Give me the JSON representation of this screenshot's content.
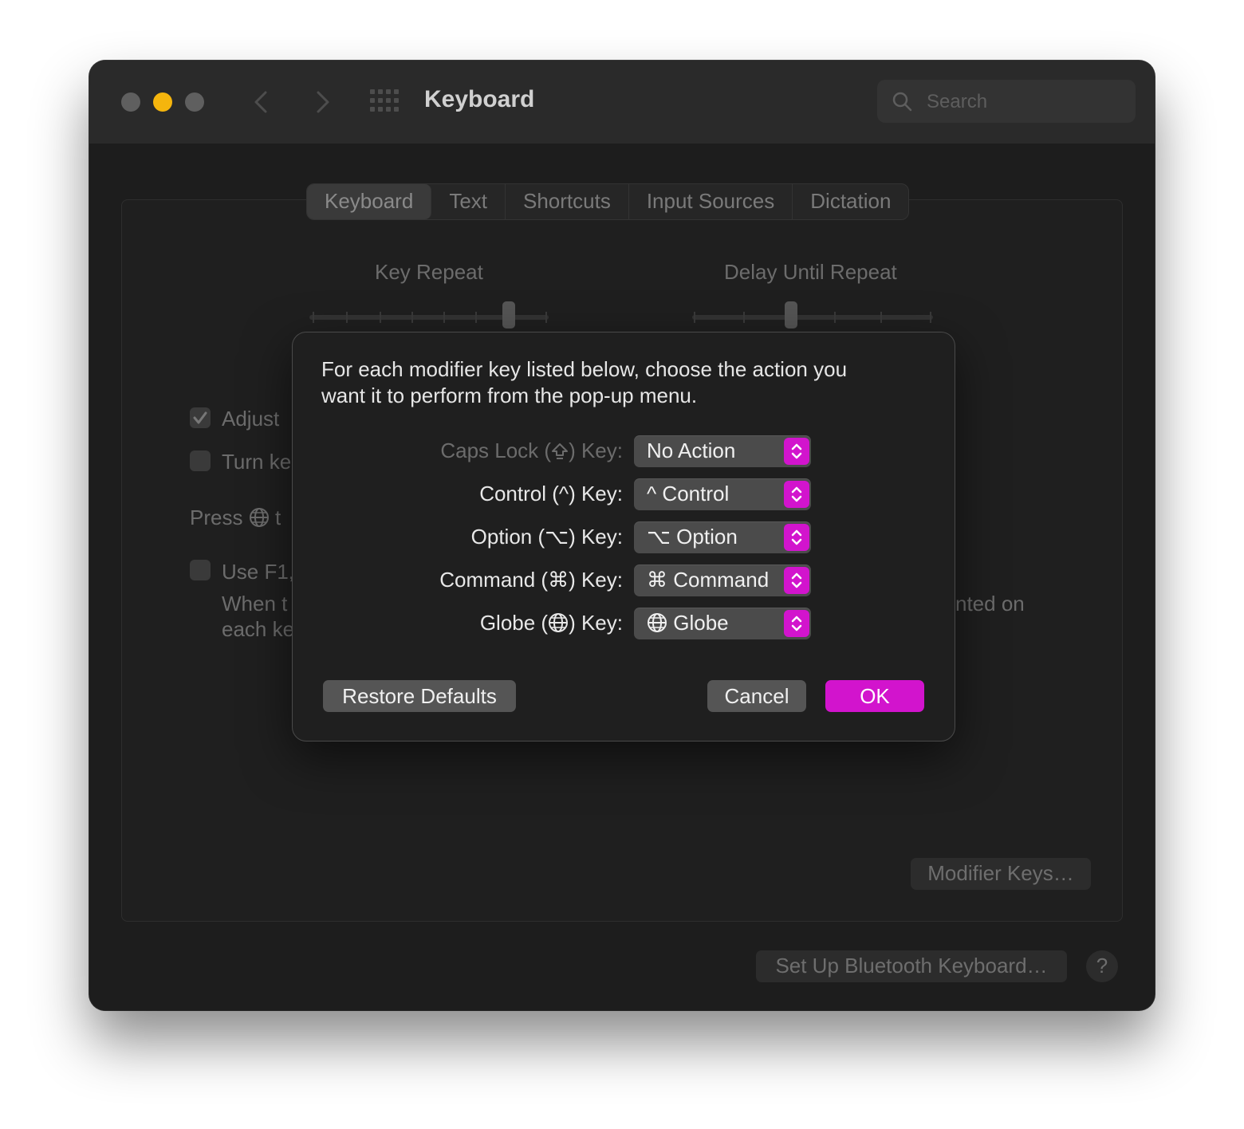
{
  "window": {
    "title": "Keyboard",
    "search_placeholder": "Search"
  },
  "tabs": [
    "Keyboard",
    "Text",
    "Shortcuts",
    "Input Sources",
    "Dictation"
  ],
  "background": {
    "key_repeat_label": "Key Repeat",
    "delay_label": "Delay Until Repeat",
    "adjust_label": "Adjust",
    "turn_label": "Turn ke",
    "press_label": "Press",
    "press_suffix": "t",
    "usef1_label": "Use F1,",
    "when_label": "When t",
    "each_label": "each ke",
    "right_fragment": "nted on",
    "modifier_keys_button": "Modifier Keys…",
    "bluetooth_button": "Set Up Bluetooth Keyboard…",
    "help_button": "?"
  },
  "dialog": {
    "line1": "For each modifier key listed below, choose the action you",
    "line2": "want it to perform from the pop-up menu.",
    "rows": [
      {
        "label_pre": "Caps Lock (",
        "label_post": ") Key:",
        "value": "No Action"
      },
      {
        "label_pre": "Control (^) Key:",
        "label_post": "",
        "value": "^ Control"
      },
      {
        "label_pre": "Option (⌥) Key:",
        "label_post": "",
        "value": "⌥ Option"
      },
      {
        "label_pre": "Command (⌘) Key:",
        "label_post": "",
        "value": "⌘ Command"
      },
      {
        "label_pre": "Globe (",
        "label_post": ") Key:",
        "value": "Globe"
      }
    ],
    "restore_defaults": "Restore Defaults",
    "cancel": "Cancel",
    "ok": "OK"
  },
  "colors": {
    "accent": "#d214cd",
    "traffic_red": "#5f5f5f",
    "traffic_yellow": "#f5b50d",
    "traffic_green": "#5f5f5f"
  }
}
